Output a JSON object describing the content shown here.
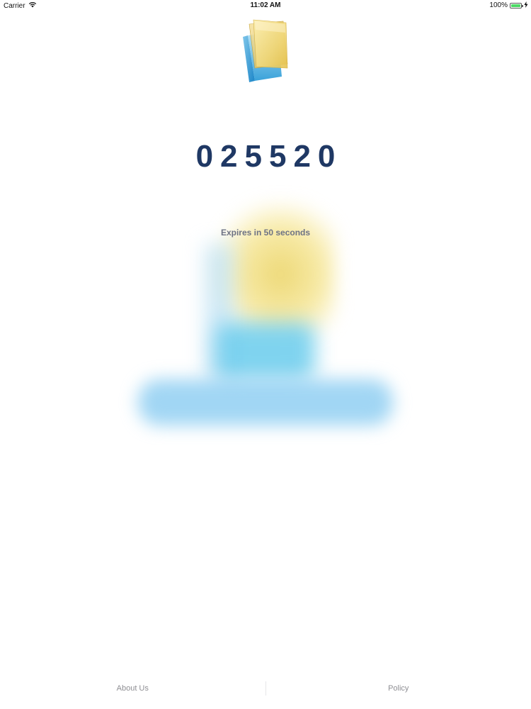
{
  "status_bar": {
    "carrier": "Carrier",
    "time": "11:02 AM",
    "battery_percent": "100%",
    "battery_level": 1.0,
    "icons": [
      "wifi-icon",
      "battery-icon",
      "charging-icon"
    ]
  },
  "logo": {
    "icon": "app-logo-icon"
  },
  "otp": {
    "code": "025520",
    "expires_text": "Expires in 50 seconds"
  },
  "footer": {
    "about_label": "About Us",
    "policy_label": "Policy"
  },
  "colors": {
    "code": "#1f3864",
    "expires": "#6e7384",
    "footer_text": "#8e8e93",
    "accent_yellow": "#ecd66e",
    "accent_blue": "#5fc8eb",
    "battery_green": "#4cd964"
  }
}
